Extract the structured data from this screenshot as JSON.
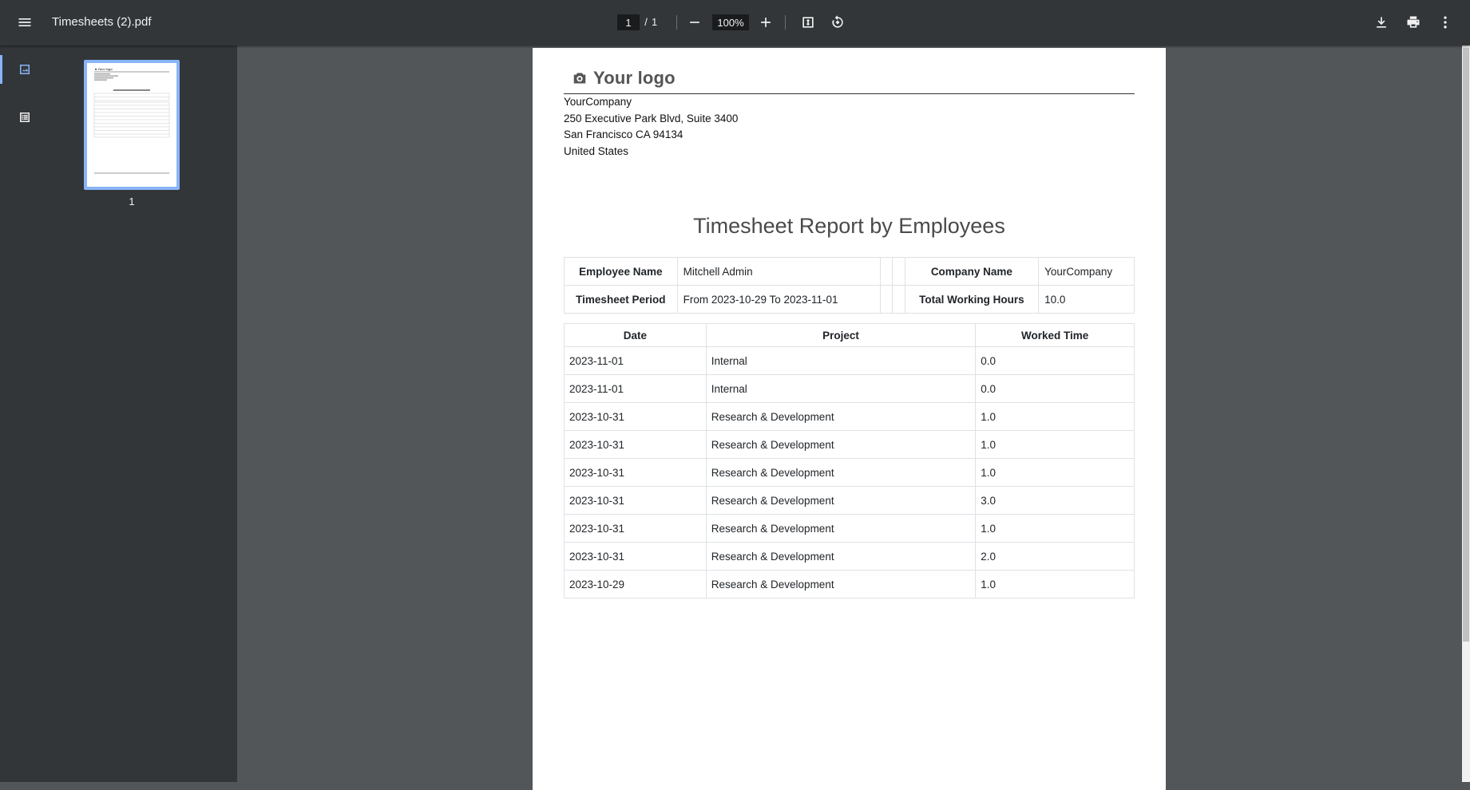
{
  "toolbar": {
    "title": "Timesheets (2).pdf",
    "current_page": "1",
    "page_separator": "/",
    "total_pages": "1",
    "zoom": "100%"
  },
  "sidebar": {
    "thumbnail_page": "1"
  },
  "document": {
    "logo_text": "Your logo",
    "address": [
      "YourCompany",
      "250 Executive Park Blvd, Suite 3400",
      "San Francisco CA 94134",
      "United States"
    ],
    "report_title": "Timesheet Report by Employees",
    "info": {
      "employee_label": "Employee Name",
      "employee_value": "Mitchell Admin",
      "company_label": "Company Name",
      "company_value": "YourCompany",
      "period_label": "Timesheet Period",
      "period_value": "From 2023-10-29 To 2023-11-01",
      "hours_label": "Total Working Hours",
      "hours_value": "10.0"
    },
    "lines": {
      "headers": [
        "Date",
        "Project",
        "Worked Time"
      ],
      "rows": [
        [
          "2023-11-01",
          "Internal",
          "0.0"
        ],
        [
          "2023-11-01",
          "Internal",
          "0.0"
        ],
        [
          "2023-10-31",
          "Research & Development",
          "1.0"
        ],
        [
          "2023-10-31",
          "Research & Development",
          "1.0"
        ],
        [
          "2023-10-31",
          "Research & Development",
          "1.0"
        ],
        [
          "2023-10-31",
          "Research & Development",
          "3.0"
        ],
        [
          "2023-10-31",
          "Research & Development",
          "1.0"
        ],
        [
          "2023-10-31",
          "Research & Development",
          "2.0"
        ],
        [
          "2023-10-29",
          "Research & Development",
          "1.0"
        ]
      ]
    }
  }
}
